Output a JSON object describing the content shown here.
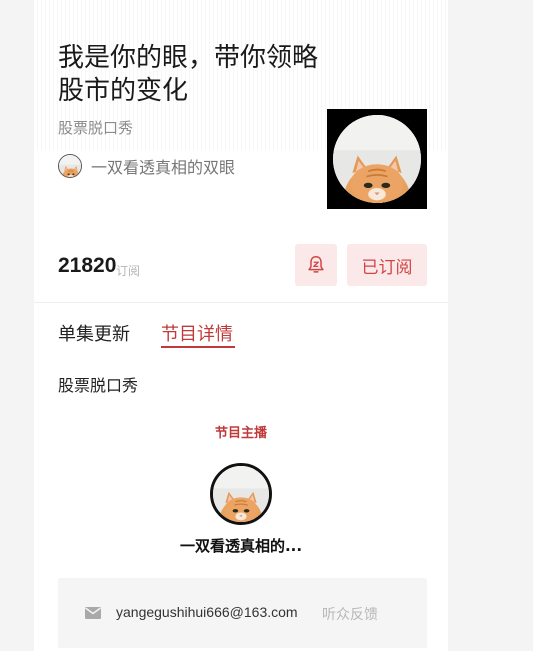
{
  "podcast": {
    "title": "我是你的眼，带你领略股市的变化",
    "category": "股票脱口秀",
    "author": "一双看透真相的双眼",
    "subscriber_count": "21820",
    "subscriber_label": "订阅",
    "subscribed_label": "已订阅",
    "cover_icon": "cat-photo"
  },
  "tabs": [
    {
      "label": "单集更新",
      "active": false
    },
    {
      "label": "节目详情",
      "active": true
    }
  ],
  "details": {
    "description": "股票脱口秀",
    "host_heading": "节目主播",
    "host_name": "一双看透真相的...",
    "email": "yangegushihui666@163.com",
    "feedback_label": "听众反馈"
  },
  "colors": {
    "accent": "#c03a3a",
    "button_bg": "#fbe9e9"
  }
}
